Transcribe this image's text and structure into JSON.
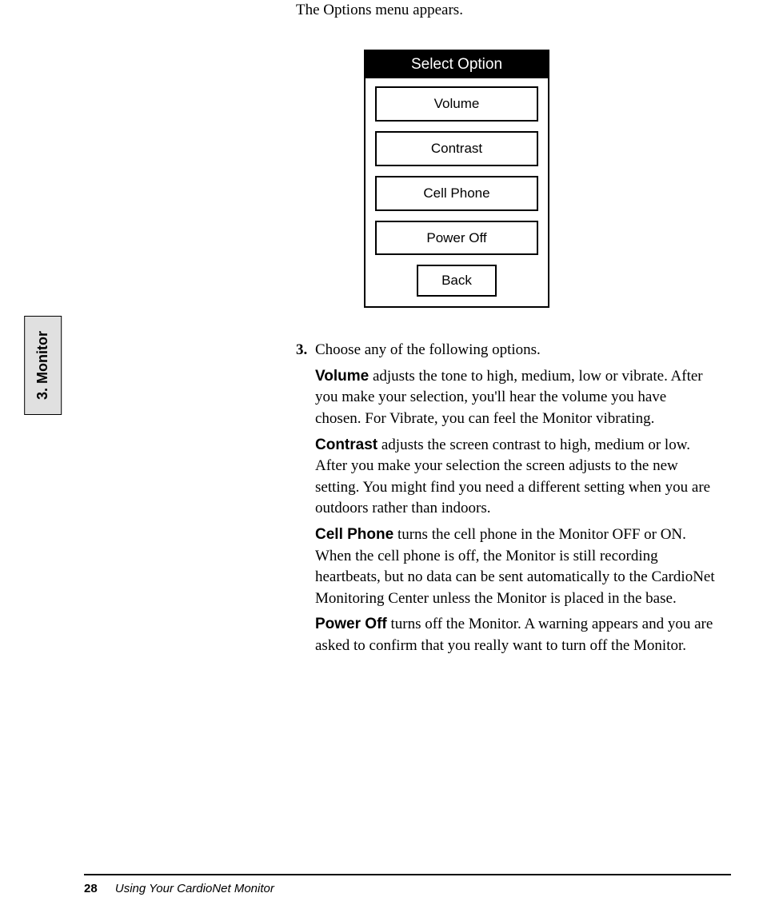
{
  "sideTab": "3. Monitor",
  "intro": "The Options menu appears.",
  "screen": {
    "title": "Select Option",
    "options": [
      "Volume",
      "Contrast",
      "Cell Phone",
      "Power Off"
    ],
    "back": "Back"
  },
  "step": {
    "num": "3.",
    "lead": "Choose any of the following options."
  },
  "paras": {
    "volume": {
      "bold": "Volume",
      "text": " adjusts the tone to high, medium, low or vibrate.  After you make your selection, you'll hear the volume you have chosen.  For Vibrate, you can feel the Monitor vibrating."
    },
    "contrast": {
      "bold": "Contrast",
      "text": " adjusts the screen contrast to high, medium or low.  After you make your selection the screen adjusts to the new setting.  You might find you need a different setting when you are outdoors rather than indoors."
    },
    "cellphone": {
      "bold": "Cell Phone",
      "text": " turns the cell phone in the Monitor OFF or ON.  When the cell phone is off, the Monitor is still recording heartbeats, but no data can be sent automatically to the CardioNet Monitoring Center unless the Monitor is placed in the base."
    },
    "poweroff": {
      "bold": "Power Off",
      "text": " turns off the Monitor. A warning appears and you are asked to confirm that you really want to turn off the Monitor."
    }
  },
  "footer": {
    "page": "28",
    "title": "Using Your CardioNet Monitor"
  }
}
